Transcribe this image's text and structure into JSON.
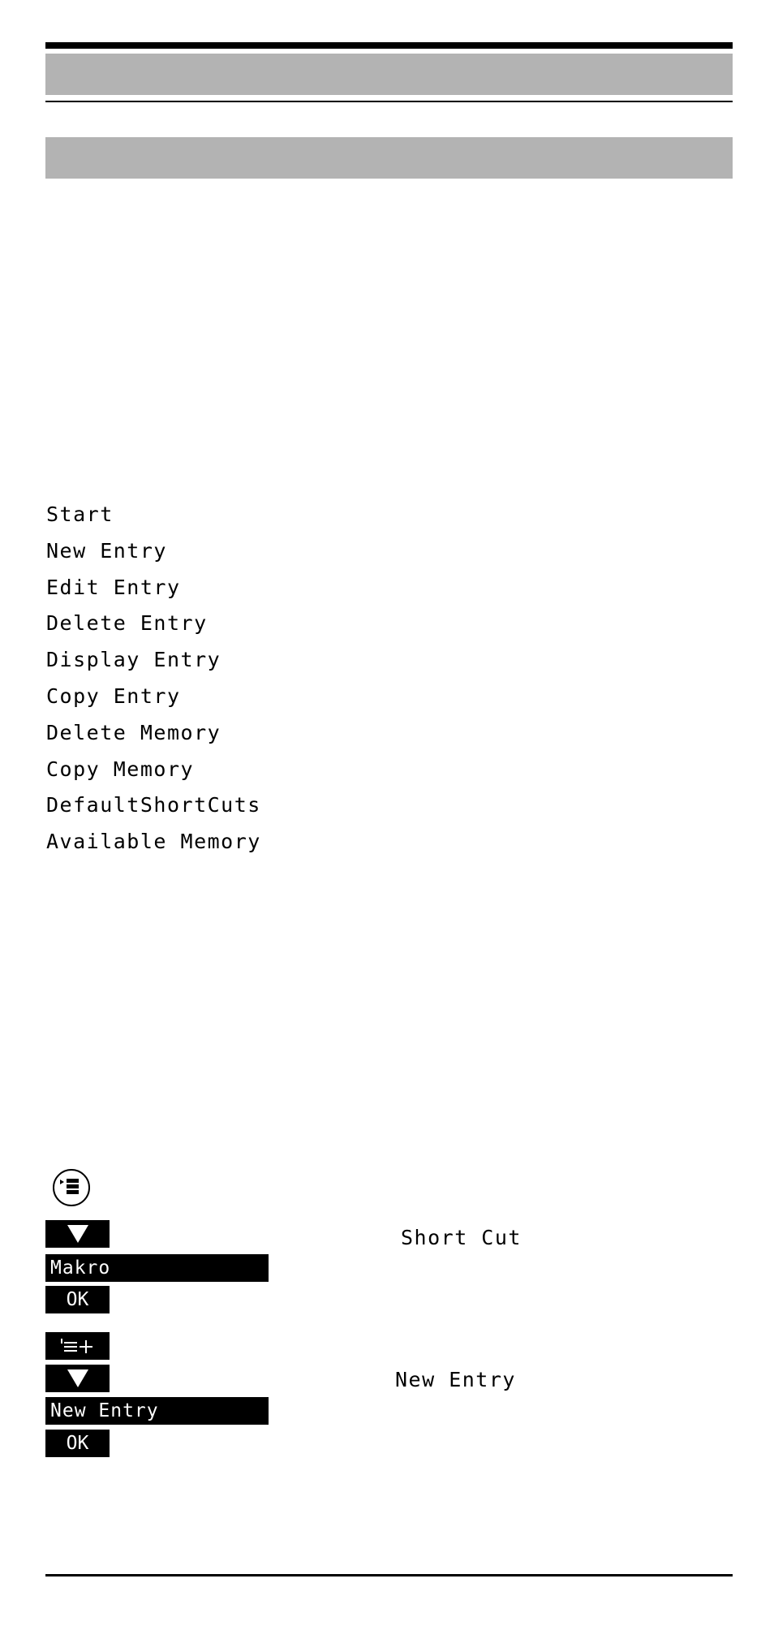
{
  "header": {
    "title_bar": "",
    "section_bar": ""
  },
  "menu": {
    "items": [
      "Start",
      "New Entry",
      "Edit Entry",
      "Delete Entry",
      "Display Entry",
      "Copy Entry",
      "Delete Memory",
      "Copy Memory",
      "DefaultShortCuts",
      "Available Memory"
    ]
  },
  "steps": {
    "menu_key_icon": "menu-list-icon",
    "group1": {
      "down_key_icon": "down-triangle-icon",
      "caption": "Short Cut",
      "display": "Makro",
      "ok_label": "OK"
    },
    "group2": {
      "add_key_label": "'≡+",
      "add_key_icon": "list-add-icon",
      "down_key_icon": "down-triangle-icon",
      "caption": "New Entry",
      "display": "New Entry",
      "ok_label": "OK"
    }
  }
}
